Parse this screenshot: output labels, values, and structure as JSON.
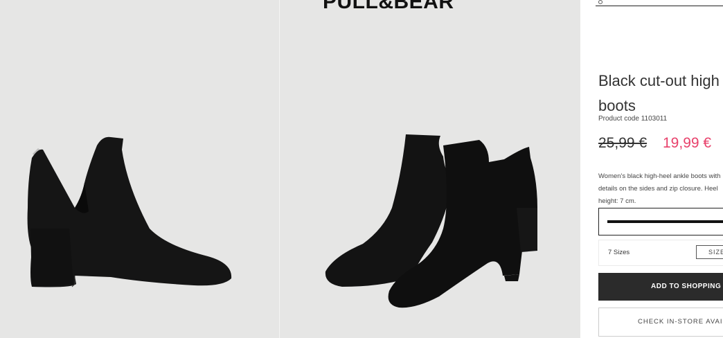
{
  "brand": {
    "logo_text": "PULL&BEAR"
  },
  "product": {
    "title": "Black cut-out high ankle boots",
    "code": "Product code 1103011",
    "price_old": "25,99 €",
    "price_new": "19,99 €",
    "description": "Women's black high-heel ankle boots with details on the sides and zip closure. Heel height: 7 cm.",
    "sizes_count": "7 Sizes",
    "size_guide_label": "SIZE GUIDE",
    "add_button_label": "ADD TO SHOPPING BASKET",
    "check_store_label": "CHECK IN-STORE AVAILABILITY"
  },
  "colors": {
    "panel_bg": "#e6e6e5",
    "sale_price": "#e8416b",
    "button_dark": "#2b2b2b"
  },
  "images": [
    {
      "name": "boot-side-view",
      "alt": ""
    },
    {
      "name": "boots-pair-front-view",
      "alt": ""
    }
  ]
}
